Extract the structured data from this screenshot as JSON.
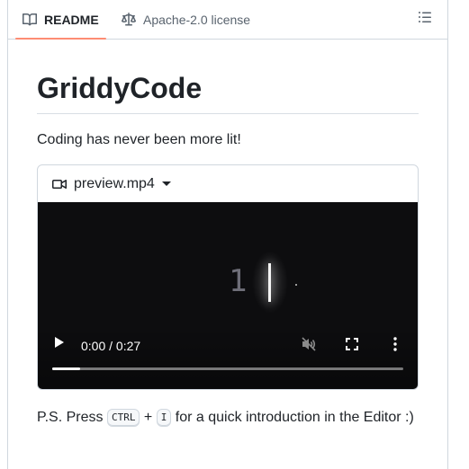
{
  "tabs": {
    "readme_label": "README",
    "license_label": "Apache-2.0 license"
  },
  "readme": {
    "title": "GriddyCode",
    "tagline": "Coding has never been more lit!",
    "video": {
      "filename": "preview.mp4",
      "editor_line_number": "1",
      "time_display": "0:00 / 0:27",
      "progress_fraction": 0.08
    },
    "ps": {
      "prefix": "P.S. Press",
      "key1": "CTRL",
      "plus": "+",
      "key2": "I",
      "suffix": "for a quick introduction in the Editor :)"
    }
  },
  "colors": {
    "tab_underline": "#fd8c73",
    "video_bg": "#0d0d0f",
    "text": "#1f2328",
    "muted": "#59636e",
    "border": "#d0d7de"
  },
  "icons": {
    "readme": "book-icon",
    "license": "law-icon",
    "outline": "list-unordered-icon",
    "video": "device-camera-video-icon",
    "dropdown": "triangle-down-icon",
    "play": "play-icon",
    "mute": "volume-muted-icon",
    "fullscreen": "fullscreen-icon",
    "more": "kebab-vertical-icon"
  }
}
